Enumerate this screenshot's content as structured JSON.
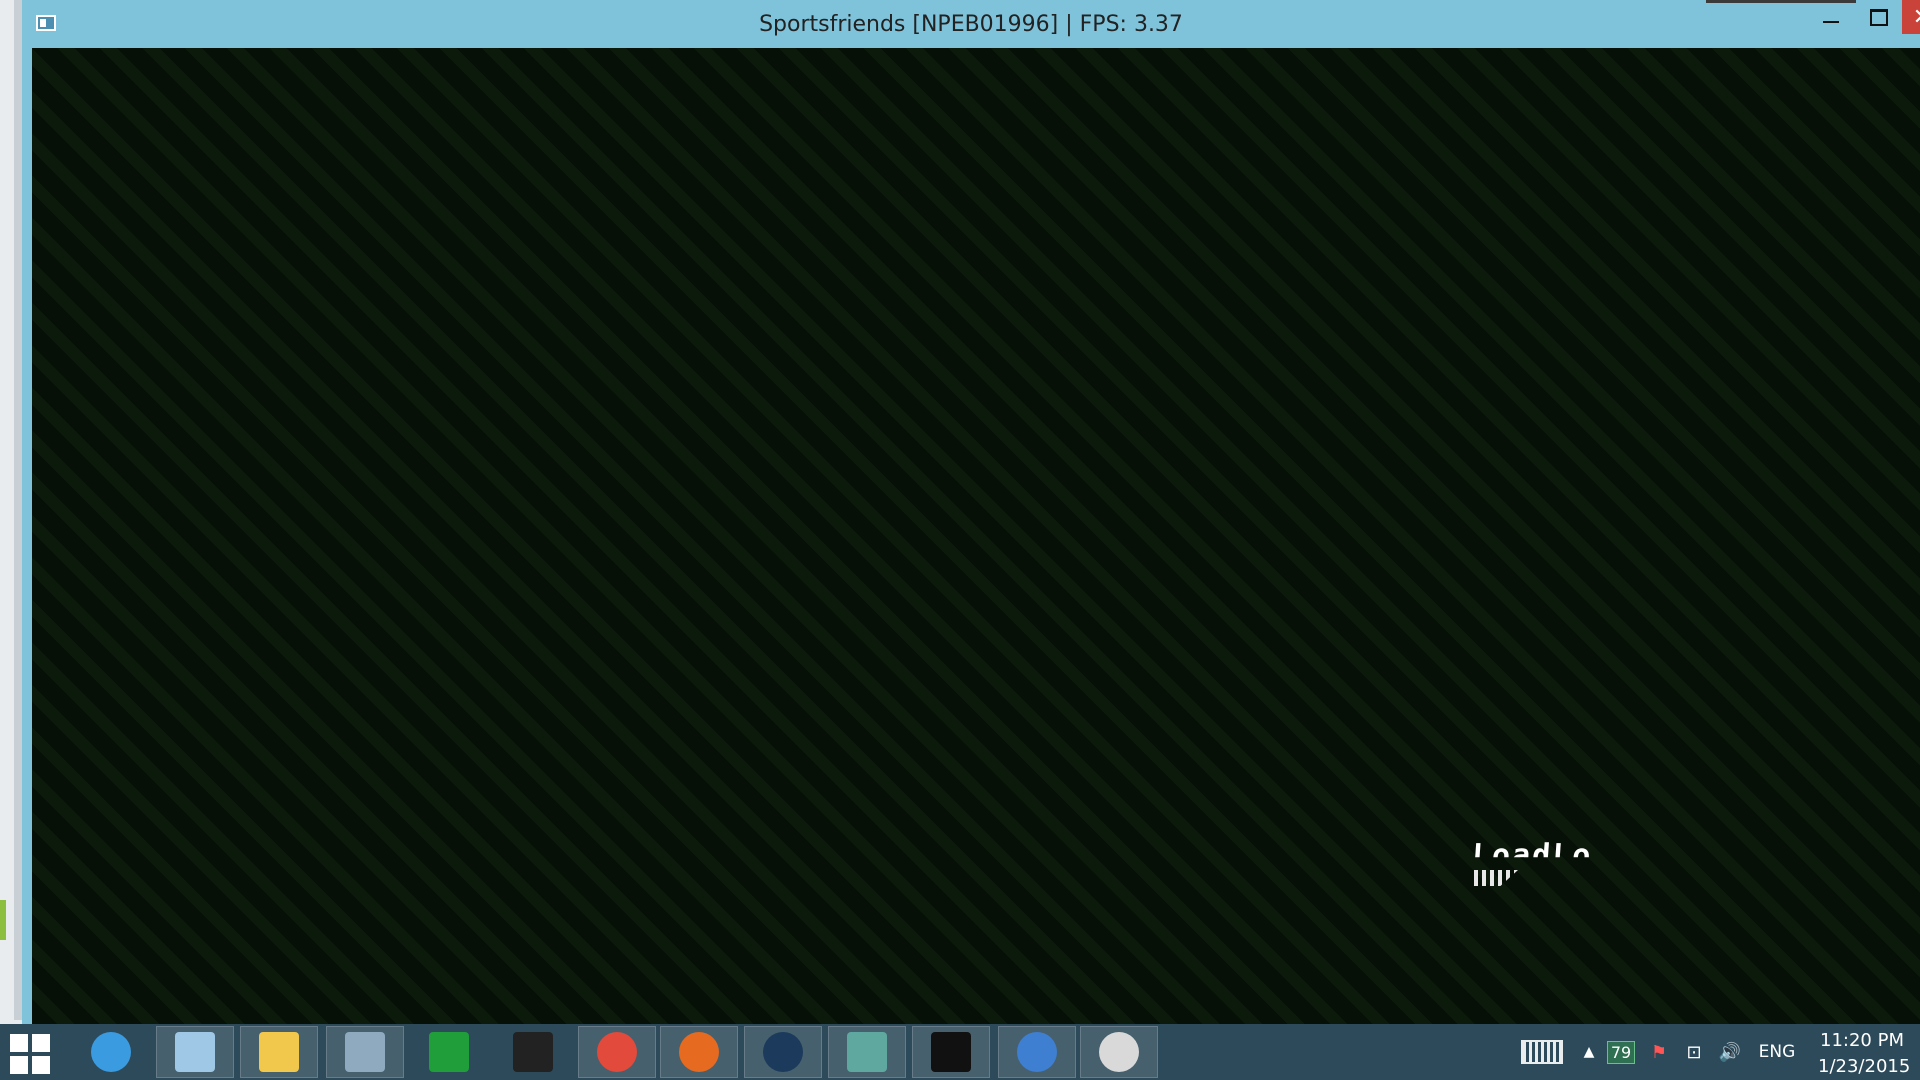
{
  "window": {
    "title": "Sportsfriends [NPEB01996] | FPS: 3.37",
    "close_label": "✕"
  },
  "game": {
    "loading_text": "LoadLo"
  },
  "taskbar": {
    "apps": [
      {
        "name": "internet-explorer-icon",
        "color": "#3b9be0"
      },
      {
        "name": "notepad-icon",
        "color": "#9fc7e6"
      },
      {
        "name": "file-explorer-icon",
        "color": "#f1c84b"
      },
      {
        "name": "calculator-icon",
        "color": "#8fa9bf"
      },
      {
        "name": "store-icon",
        "color": "#1f9e3a"
      },
      {
        "name": "unity-icon",
        "color": "#222222"
      },
      {
        "name": "chrome-icon",
        "color": "#e24a3b"
      },
      {
        "name": "firefox-icon",
        "color": "#e66a1f"
      },
      {
        "name": "steam-icon",
        "color": "#1b3a5c"
      },
      {
        "name": "emulator-icon",
        "color": "#5fa8a0"
      },
      {
        "name": "illegal-icon",
        "color": "#111111"
      },
      {
        "name": "ccleaner-icon",
        "color": "#3f7fd1"
      },
      {
        "name": "compass-icon",
        "color": "#d9d9d9"
      }
    ],
    "tray": {
      "battery": "79",
      "language": "ENG",
      "time": "11:20 PM",
      "date": "1/23/2015"
    }
  }
}
